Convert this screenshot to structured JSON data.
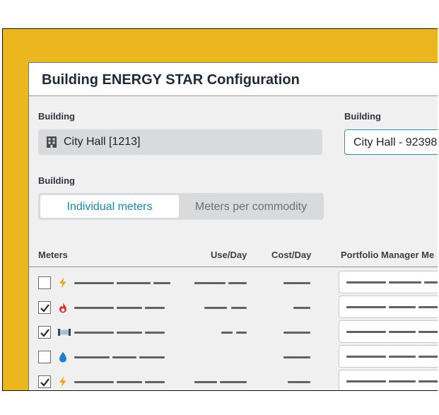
{
  "dialog": {
    "title": "Building ENERGY STAR Configuration"
  },
  "building_section": {
    "label": "Building",
    "value": "City Hall [1213]",
    "icon": "building-icon"
  },
  "pm_building_section": {
    "label": "Building",
    "value": "City Hall - 92398"
  },
  "meter_mode": {
    "label": "Building",
    "options": [
      "Individual meters",
      "Meters per commodity"
    ],
    "selected": "Individual meters"
  },
  "meters_table": {
    "columns": [
      "Meters",
      "Use/Day",
      "Cost/Day",
      "Portfolio Manager Me"
    ],
    "rows": [
      {
        "checked": false,
        "icon": "electricity-icon"
      },
      {
        "checked": true,
        "icon": "gas-flame-icon"
      },
      {
        "checked": true,
        "icon": "steam-pipe-icon"
      },
      {
        "checked": false,
        "icon": "water-drop-icon"
      },
      {
        "checked": true,
        "icon": "electricity-icon"
      }
    ]
  },
  "colors": {
    "frame_background": "#ebb61e",
    "accent": "#1f87a8",
    "electricity": "#f0a41b",
    "gas": "#e0312f",
    "water": "#1f7fd1"
  }
}
